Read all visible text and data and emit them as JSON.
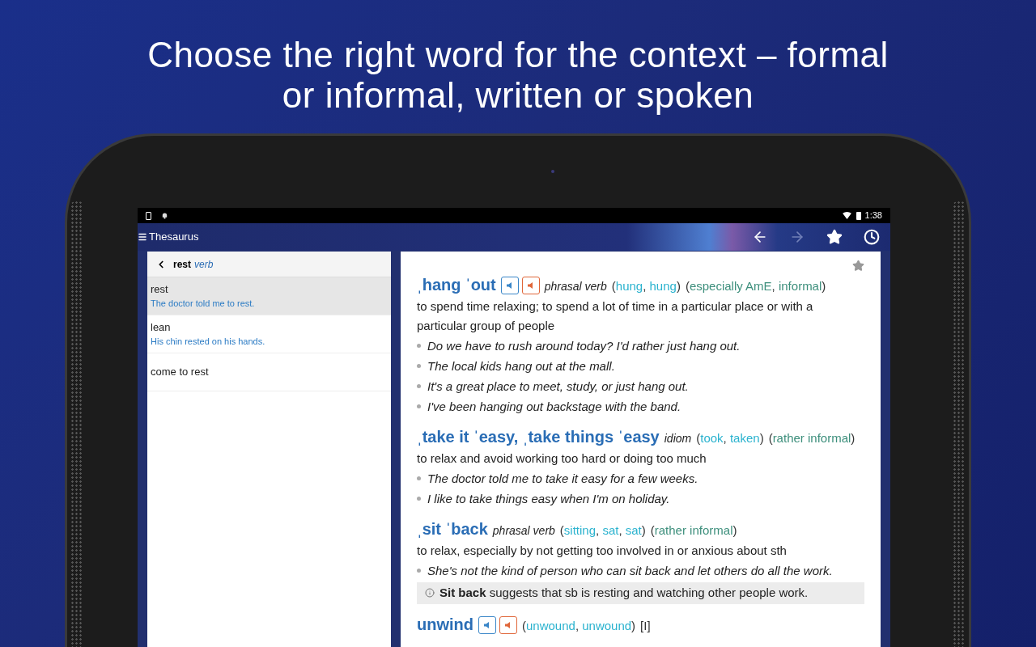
{
  "headline": [
    "Choose the right word for the context – formal",
    "or informal, written or spoken"
  ],
  "status_bar": {
    "time": "1:38"
  },
  "app_bar": {
    "title": "Thesaurus",
    "actions": [
      {
        "kind": "back",
        "disabled": false
      },
      {
        "kind": "forward",
        "disabled": true
      },
      {
        "kind": "favorites",
        "disabled": false
      },
      {
        "kind": "history",
        "disabled": false
      }
    ]
  },
  "sidebar": {
    "headword": "rest",
    "part_of_speech": "verb",
    "items": [
      {
        "word": "rest",
        "example": "The doctor told me to rest.",
        "selected": true
      },
      {
        "word": "lean",
        "example": "His chin rested on his hands.",
        "selected": false
      },
      {
        "word": "come to rest",
        "selected": false
      }
    ]
  },
  "entries": [
    {
      "headword": "ˌhang ˈout",
      "audio": true,
      "part_of_speech": "phrasal verb",
      "forms": "(hung, hung)",
      "register": "(especially AmE, informal)",
      "definition": "to spend time relaxing; to spend a lot of time in a particular place or with a particular group of people",
      "examples": [
        "Do we have to rush around today? I'd rather just hang out.",
        "The local kids hang out at the mall.",
        "It's a great place to meet, study, or just hang out.",
        "I've been hanging out backstage with the band."
      ]
    },
    {
      "headword": "ˌtake it ˈeasy, ˌtake things ˈeasy",
      "audio": false,
      "part_of_speech": "idiom",
      "forms": "(took, taken)",
      "register": "(rather informal)",
      "definition": "to relax and avoid working too hard or doing too much",
      "examples": [
        "The doctor told me to take it easy for a few weeks.",
        "I like to take things easy when I'm on holiday."
      ]
    },
    {
      "headword": "ˌsit ˈback",
      "audio": false,
      "part_of_speech": "phrasal verb",
      "forms": "(sitting, sat, sat)",
      "register": "(rather informal)",
      "definition": "to relax, especially by not getting too involved in or anxious about sth",
      "examples": [
        "She's not the kind of person who can sit back and let others do all the work."
      ],
      "note": "**Sit back** suggests that sb is resting and watching other people work."
    },
    {
      "headword": "unwind",
      "audio": true,
      "forms": "(unwound, unwound)",
      "grammar": "[I]"
    }
  ]
}
